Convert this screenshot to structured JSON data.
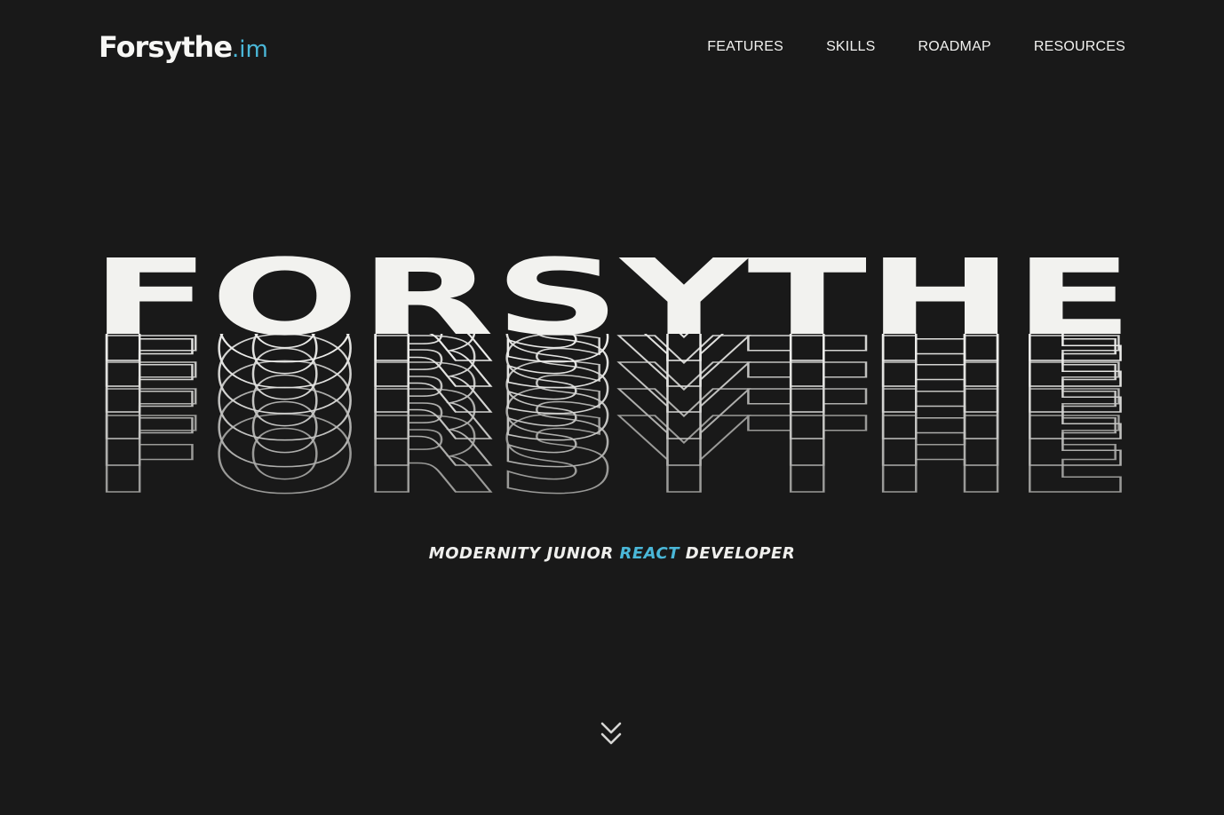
{
  "header": {
    "logo_main": "Forsythe",
    "logo_tld": ".im",
    "nav": [
      {
        "label": "FEATURES"
      },
      {
        "label": "SKILLS"
      },
      {
        "label": "ROADMAP"
      },
      {
        "label": "RESOURCES"
      }
    ]
  },
  "hero": {
    "title": "FORSYTHE",
    "subtitle_before": "MODERNITY JUNIOR ",
    "subtitle_accent": "REACT",
    "subtitle_after": " DEVELOPER"
  },
  "scroll": {
    "icon": "chevrons-down-icon"
  },
  "colors": {
    "background": "#191919",
    "text": "#f2f2f0",
    "accent": "#4ab7d8"
  }
}
